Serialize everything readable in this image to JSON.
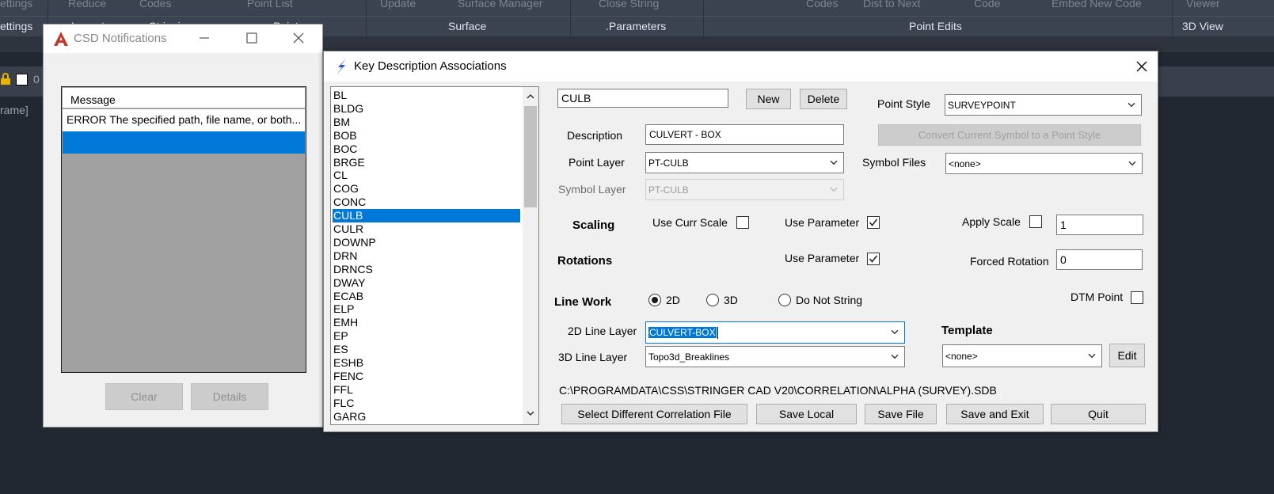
{
  "background": {
    "ribbon_top_items": [
      "ettings",
      "Reduce",
      "Codes",
      "Point List",
      "Update",
      "Surface Manager",
      "Close String",
      "Codes",
      "Dist to Next",
      "Code",
      "Embed New Code",
      "Viewer"
    ],
    "ribbon_panels": [
      "ettings",
      "Layout",
      "Stringing",
      "Point",
      "Surface",
      ".Parameters",
      "Point Edits",
      "3D View"
    ],
    "side_text": "rame]",
    "layer_num": "0"
  },
  "csd": {
    "title": "CSD Notifications",
    "header": "Message",
    "messages": [
      "ERROR The specified path, file name, or both..."
    ],
    "clear_label": "Clear",
    "details_label": "Details"
  },
  "kda": {
    "title": "Key Description Associations",
    "list": [
      "BL",
      "BLDG",
      "BM",
      "BOB",
      "BOC",
      "BRGE",
      "CL",
      "COG",
      "CONC",
      "CULB",
      "CULR",
      "DOWNP",
      "DRN",
      "DRNCS",
      "DWAY",
      "ECAB",
      "ELP",
      "EMH",
      "EP",
      "ES",
      "ESHB",
      "FENC",
      "FFL",
      "FLC",
      "GARG"
    ],
    "selected_index": 9,
    "code_value": "CULB",
    "new_label": "New",
    "delete_label": "Delete",
    "point_style_label": "Point Style",
    "point_style_value": "SURVEYPOINT",
    "convert_label": "Convert Current Symbol to a Point Style",
    "description_label": "Description",
    "description_value": "CULVERT - BOX",
    "point_layer_label": "Point Layer",
    "point_layer_value": "PT-CULB",
    "symbol_files_label": "Symbol Files",
    "symbol_files_value": "<none>",
    "symbol_layer_label": "Symbol Layer",
    "symbol_layer_value": "PT-CULB",
    "scaling_label": "Scaling",
    "use_curr_scale_label": "Use Curr Scale",
    "use_curr_scale_checked": false,
    "scaling_use_param_label": "Use Parameter",
    "scaling_use_param_checked": true,
    "apply_scale_label": "Apply Scale",
    "apply_scale_checked": false,
    "apply_scale_value": "1",
    "rotations_label": "Rotations",
    "rot_use_param_label": "Use Parameter",
    "rot_use_param_checked": true,
    "forced_rotation_label": "Forced Rotation",
    "forced_rotation_value": "0",
    "linework_label": "Line Work",
    "radio_2d_label": "2D",
    "radio_3d_label": "3D",
    "radio_nostring_label": "Do Not String",
    "linework_selected": "2D",
    "dtm_point_label": "DTM Point",
    "dtm_point_checked": false,
    "line2d_label": "2D Line Layer",
    "line2d_value": "CULVERT-BOX",
    "line3d_label": "3D Line Layer",
    "line3d_value": "Topo3d_Breaklines",
    "template_label": "Template",
    "template_value": "<none>",
    "edit_label": "Edit",
    "path_text": "C:\\PROGRAMDATA\\CSS\\STRINGER CAD V20\\CORRELATION\\ALPHA (SURVEY).SDB",
    "select_file_label": "Select Different Correlation File",
    "save_local_label": "Save Local",
    "save_file_label": "Save File",
    "save_exit_label": "Save and Exit",
    "quit_label": "Quit"
  },
  "colors": {
    "selection": "#0078d7",
    "cad_background": "#222831",
    "autocad_red": "#c0392b"
  }
}
